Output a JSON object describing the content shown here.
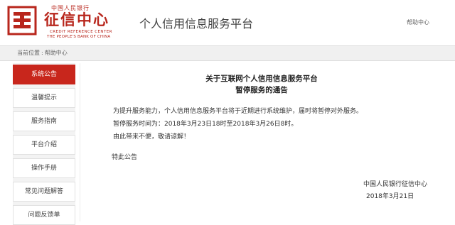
{
  "header": {
    "logo": {
      "cn_small": "中国人民银行",
      "cn_title": "征信中心",
      "en_line1": "CREDIT REFERENCE CENTER",
      "en_line2": "THE PEOPLE'S BANK OF CHINA",
      "brand_color": "#b8261c",
      "icon": "credit-center-emblem-icon"
    },
    "site_title": "个人信用信息服务平台",
    "help_link": "帮助中心"
  },
  "breadcrumb": {
    "prefix": "当前位置",
    "separator": ":",
    "current": "帮助中心"
  },
  "sidebar": {
    "active_color": "#c8261c",
    "items": [
      {
        "label": "系统公告",
        "active": true
      },
      {
        "label": "温馨提示",
        "active": false
      },
      {
        "label": "服务指南",
        "active": false
      },
      {
        "label": "平台介绍",
        "active": false
      },
      {
        "label": "操作手册",
        "active": false
      },
      {
        "label": "常见问题解答",
        "active": false
      },
      {
        "label": "问题反馈单",
        "active": false
      }
    ]
  },
  "notice": {
    "title": "关于互联网个人信用信息服务平台",
    "subtitle": "暂停服务的通告",
    "paragraphs": [
      "为提升服务能力，个人信用信息服务平台将于近期进行系统维护，届时将暂停对外服务。",
      "暂停服务时间为：2018年3月23日18时至2018年3月26日8时。",
      "由此带来不便，敬请谅解！"
    ],
    "signoff": "特此公告",
    "issuer": "中国人民银行征信中心",
    "date": "2018年3月21日"
  }
}
